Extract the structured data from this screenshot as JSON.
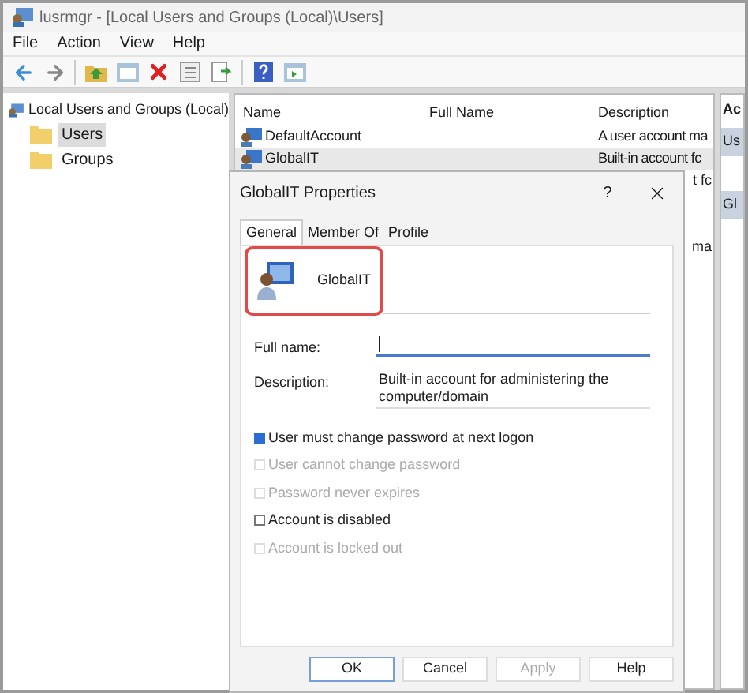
{
  "window": {
    "title": "lusrmgr - [Local Users and Groups (Local)\\Users]"
  },
  "menu": [
    "File",
    "Action",
    "View",
    "Help"
  ],
  "tree": {
    "label": "Local Users and Groups (Local)",
    "children": [
      {
        "label": "Users",
        "selected": true
      },
      {
        "label": "Groups",
        "selected": false
      }
    ]
  },
  "list": {
    "columns": [
      "Name",
      "Full Name",
      "Description"
    ],
    "rows": [
      {
        "kind": "full",
        "name": "DefaultAccount",
        "description": "A user account ma",
        "selected": false
      },
      {
        "kind": "full",
        "name": "GlobalIT",
        "description": "Built-in account fc",
        "selected": true
      },
      {
        "kind": "tail",
        "description": "t fc"
      },
      {
        "kind": "tail"
      },
      {
        "kind": "tail"
      },
      {
        "kind": "tail",
        "description": "ma"
      }
    ]
  },
  "actions": {
    "header": "Ac",
    "sections": [
      "Us",
      "Gl"
    ]
  },
  "dialog": {
    "title": "GlobalIT Properties",
    "help": "?",
    "tabs": [
      {
        "label": "General",
        "selected": true
      },
      {
        "label": "Member Of",
        "selected": false
      },
      {
        "label": "Profile",
        "selected": false
      }
    ],
    "user_name": "GlobalIT",
    "fields": [
      {
        "label": "Full name:",
        "focused": true
      },
      {
        "label": "Description:",
        "value": "Built-in account for administering the computer/domain",
        "focused": false
      }
    ],
    "checkboxes": [
      {
        "label": "User must change password at next logon",
        "checked": true,
        "disabled": false
      },
      {
        "label": "User cannot change password",
        "checked": false,
        "disabled": true
      },
      {
        "label": "Password never expires",
        "checked": false,
        "disabled": true
      },
      {
        "label": "Account is disabled",
        "checked": false,
        "disabled": false
      },
      {
        "label": "Account is locked out",
        "checked": false,
        "disabled": true
      }
    ],
    "buttons": [
      {
        "label": "OK",
        "disabled": false,
        "default": true
      },
      {
        "label": "Cancel",
        "disabled": false,
        "default": false
      },
      {
        "label": "Apply",
        "disabled": true,
        "default": false
      },
      {
        "label": "Help",
        "disabled": false,
        "default": false
      }
    ]
  }
}
